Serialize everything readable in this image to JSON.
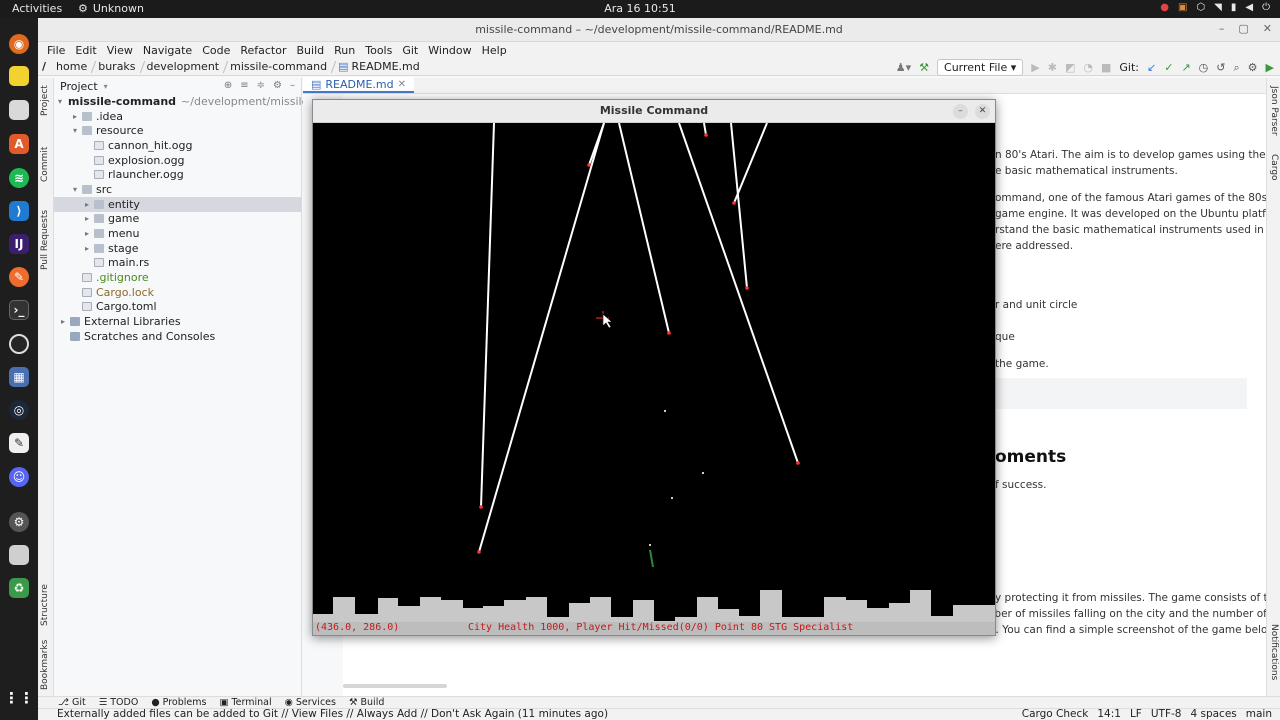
{
  "topbar": {
    "activities": "Activities",
    "app_name": "Unknown",
    "clock": "Ara 16  10:51"
  },
  "ide": {
    "window_title": "missile-command – ~/development/missile-command/README.md",
    "menu": [
      "File",
      "Edit",
      "View",
      "Navigate",
      "Code",
      "Refactor",
      "Build",
      "Run",
      "Tools",
      "Git",
      "Window",
      "Help"
    ],
    "breadcrumbs": [
      "/",
      "home",
      "buraks",
      "development",
      "missile-command",
      "README.md"
    ],
    "run_config": "Current File",
    "git_label": "Git:",
    "left_strip": [
      "Project",
      "Commit",
      "Pull Requests",
      "Structure",
      "Bookmarks"
    ],
    "right_strip": [
      "Json Parser",
      "Cargo",
      "Notifications"
    ]
  },
  "project": {
    "header": "Project",
    "root": "missile-command",
    "root_hint": "~/development/missile-comm",
    "items": [
      {
        "label": ".idea",
        "kind": "folder",
        "indent": 1,
        "arrow": "▸"
      },
      {
        "label": "resource",
        "kind": "folder",
        "indent": 1,
        "arrow": "▾"
      },
      {
        "label": "cannon_hit.ogg",
        "kind": "file",
        "indent": 2,
        "arrow": ""
      },
      {
        "label": "explosion.ogg",
        "kind": "file",
        "indent": 2,
        "arrow": ""
      },
      {
        "label": "rlauncher.ogg",
        "kind": "file",
        "indent": 2,
        "arrow": ""
      },
      {
        "label": "src",
        "kind": "folder",
        "indent": 1,
        "arrow": "▾"
      },
      {
        "label": "entity",
        "kind": "folder",
        "indent": 2,
        "arrow": "▸",
        "selected": true
      },
      {
        "label": "game",
        "kind": "folder",
        "indent": 2,
        "arrow": "▸"
      },
      {
        "label": "menu",
        "kind": "folder",
        "indent": 2,
        "arrow": "▸"
      },
      {
        "label": "stage",
        "kind": "folder",
        "indent": 2,
        "arrow": "▸"
      },
      {
        "label": "main.rs",
        "kind": "file",
        "indent": 2,
        "arrow": ""
      },
      {
        "label": ".gitignore",
        "kind": "file",
        "indent": 1,
        "arrow": "",
        "git": "add"
      },
      {
        "label": "Cargo.lock",
        "kind": "file",
        "indent": 1,
        "arrow": "",
        "git": "unv"
      },
      {
        "label": "Cargo.toml",
        "kind": "file",
        "indent": 1,
        "arrow": ""
      },
      {
        "label": "External Libraries",
        "kind": "lib",
        "indent": 0,
        "arrow": "▸"
      },
      {
        "label": "Scratches and Consoles",
        "kind": "lib",
        "indent": 0,
        "arrow": ""
      }
    ]
  },
  "editor": {
    "tab": "README.md",
    "preview": {
      "line1": "n 80's Atari. The aim is to develop games using the",
      "line2": "e basic mathematical instruments.",
      "line3": "ommand, one of the famous Atari games of the 80s.",
      "line4": "game engine. It was developed on the Ubuntu platform.",
      "line5": "rstand the basic mathematical instruments used in game",
      "line6": "ere addressed.",
      "line7": "r and unit circle",
      "line8": "que",
      "line9": "the game.",
      "heading": "oments",
      "line10": "f success.",
      "line11": "y protecting it from missiles. The game consists of three",
      "line12": "levels. Each level increases the number of missiles falling on the city and the number of",
      "line13": "countermeasures the player can use. You can find a simple screenshot of the game below."
    }
  },
  "game": {
    "title": "Missile Command",
    "coords": "(436.0, 286.0)",
    "status": "City Health 1000, Player Hit/Missed(0/0) Point 80 STG Specialist",
    "minimize_icon": "minimize-icon",
    "close_icon": "close-icon"
  },
  "bottom_tabs": [
    "Git",
    "TODO",
    "Problems",
    "Terminal",
    "Services",
    "Build"
  ],
  "status": {
    "message": "Externally added files can be added to Git // View Files // Always Add // Don't Ask Again (11 minutes ago)",
    "right": [
      "Cargo Check",
      "14:1",
      "LF",
      "UTF-8",
      "4 spaces",
      "main"
    ]
  }
}
